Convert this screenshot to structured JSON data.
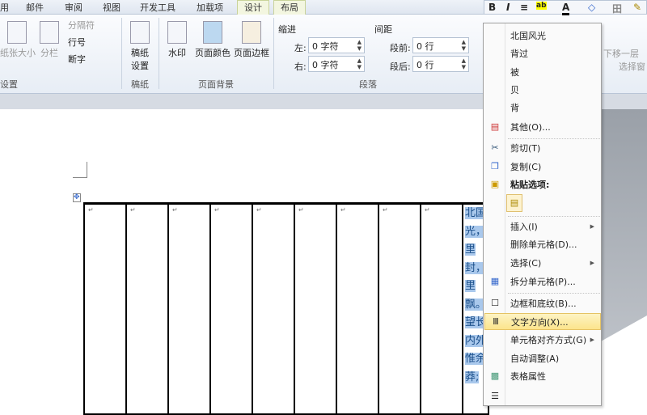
{
  "tabs": [
    "用",
    "邮件",
    "审阅",
    "视图",
    "开发工具",
    "加载项",
    "设计",
    "布局"
  ],
  "ribbon": {
    "page_setup": {
      "paper_size": "纸张大小",
      "columns": "分栏",
      "breaks": "分隔符",
      "line_numbers": "行号",
      "hyphenation": "断字",
      "label": "设置"
    },
    "manuscript": {
      "btn1": "稿纸",
      "btn2": "设置",
      "label": "稿纸"
    },
    "background": {
      "watermark": "水印",
      "page_color": "页面颜色",
      "page_borders": "页面边框",
      "label": "页面背景"
    },
    "paragraph": {
      "indent": "缩进",
      "left": "左:",
      "left_value": "0 字符",
      "right": "右:",
      "right_value": "0 字符",
      "spacing": "间距",
      "before": "段前:",
      "before_value": "0 行",
      "after": "段后:",
      "after_value": "0 行",
      "label": "段落"
    },
    "arrange": {
      "layer": "下移一层",
      "select": "选择窗"
    }
  },
  "document": {
    "cell_text": [
      "北国",
      "光，",
      "里",
      "封，",
      "里",
      "飘。",
      "望长",
      "内外",
      "惟余",
      "莽;"
    ]
  },
  "mini_toolbar": [
    "B",
    "I",
    "≡",
    "ab",
    "A",
    "◇",
    "田",
    "✎"
  ],
  "context_menu": {
    "suggestions": [
      "北国风光",
      "背过",
      "被",
      "贝",
      "背"
    ],
    "other": "其他(O)...",
    "cut": "剪切(T)",
    "copy": "复制(C)",
    "paste_options": "粘贴选项:",
    "insert": "插入(I)",
    "delete_cells": "删除单元格(D)...",
    "select": "选择(C)",
    "split_cells": "拆分单元格(P)...",
    "borders": "边框和底纹(B)...",
    "text_direction": "文字方向(X)...",
    "cell_alignment": "单元格对齐方式(G)",
    "autofit": "自动调整(A)",
    "table_properties": "表格属性"
  }
}
